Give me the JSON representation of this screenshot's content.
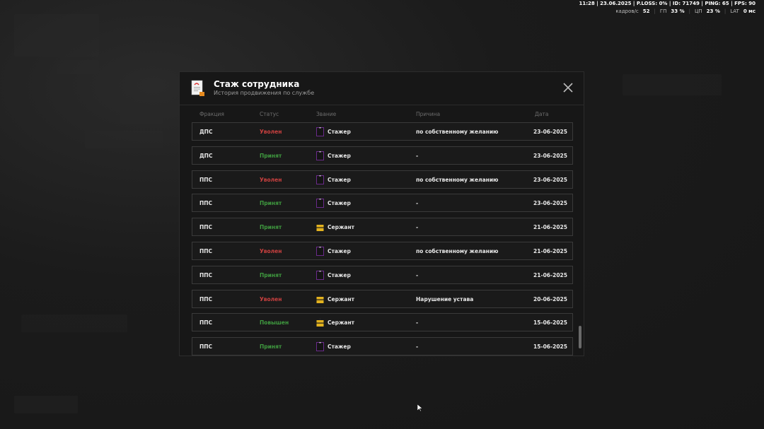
{
  "hud": {
    "top_line": "11:28 | 23.06.2025 | P.LOSS: 0% | ID: 71749 | PING: 65 | FPS: 90",
    "fps_label": "кадров/с",
    "fps_value": "52",
    "gpu_label": "ГП",
    "gpu_value": "33 %",
    "cpu_label": "ЦП",
    "cpu_value": "23 %",
    "lat_label": "LAT",
    "lat_value": "0 мс"
  },
  "modal": {
    "title": "Стаж сотрудника",
    "subtitle": "История продвижения по службе",
    "columns": {
      "fraction": "Фракция",
      "status": "Статус",
      "rank": "Звание",
      "reason": "Причина",
      "date": "Дата"
    },
    "rows": [
      {
        "fraction": "ДПС",
        "status": "Уволен",
        "status_color": "red",
        "rank": "Стажер",
        "rank_icon": "trainee-badge-icon",
        "reason": "по собственному желанию",
        "date": "23-06-2025"
      },
      {
        "fraction": "ДПС",
        "status": "Принят",
        "status_color": "green",
        "rank": "Стажер",
        "rank_icon": "trainee-badge-icon",
        "reason": "-",
        "date": "23-06-2025"
      },
      {
        "fraction": "ППС",
        "status": "Уволен",
        "status_color": "red",
        "rank": "Стажер",
        "rank_icon": "trainee-badge-icon",
        "reason": "по собственному желанию",
        "date": "23-06-2025"
      },
      {
        "fraction": "ППС",
        "status": "Принят",
        "status_color": "green",
        "rank": "Стажер",
        "rank_icon": "trainee-badge-icon",
        "reason": "-",
        "date": "23-06-2025"
      },
      {
        "fraction": "ППС",
        "status": "Принят",
        "status_color": "green",
        "rank": "Сержант",
        "rank_icon": "sergeant-badge-icon",
        "reason": "-",
        "date": "21-06-2025"
      },
      {
        "fraction": "ППС",
        "status": "Уволен",
        "status_color": "red",
        "rank": "Стажер",
        "rank_icon": "trainee-badge-icon",
        "reason": "по собственному желанию",
        "date": "21-06-2025"
      },
      {
        "fraction": "ППС",
        "status": "Принят",
        "status_color": "green",
        "rank": "Стажер",
        "rank_icon": "trainee-badge-icon",
        "reason": "-",
        "date": "21-06-2025"
      },
      {
        "fraction": "ППС",
        "status": "Уволен",
        "status_color": "red",
        "rank": "Сержант",
        "rank_icon": "sergeant-badge-icon",
        "reason": "Нарушение устава",
        "date": "20-06-2025"
      },
      {
        "fraction": "ППС",
        "status": "Повышен",
        "status_color": "green",
        "rank": "Сержант",
        "rank_icon": "sergeant-badge-icon",
        "reason": "-",
        "date": "15-06-2025"
      },
      {
        "fraction": "ППС",
        "status": "Принят",
        "status_color": "green",
        "rank": "Стажер",
        "rank_icon": "trainee-badge-icon",
        "reason": "-",
        "date": "15-06-2025"
      }
    ]
  },
  "colors": {
    "status_red": "#c9403f",
    "status_green": "#3f9a3f",
    "sergeant_gold": "#e3b21f",
    "trainee_purple": "#6a2a8a"
  }
}
